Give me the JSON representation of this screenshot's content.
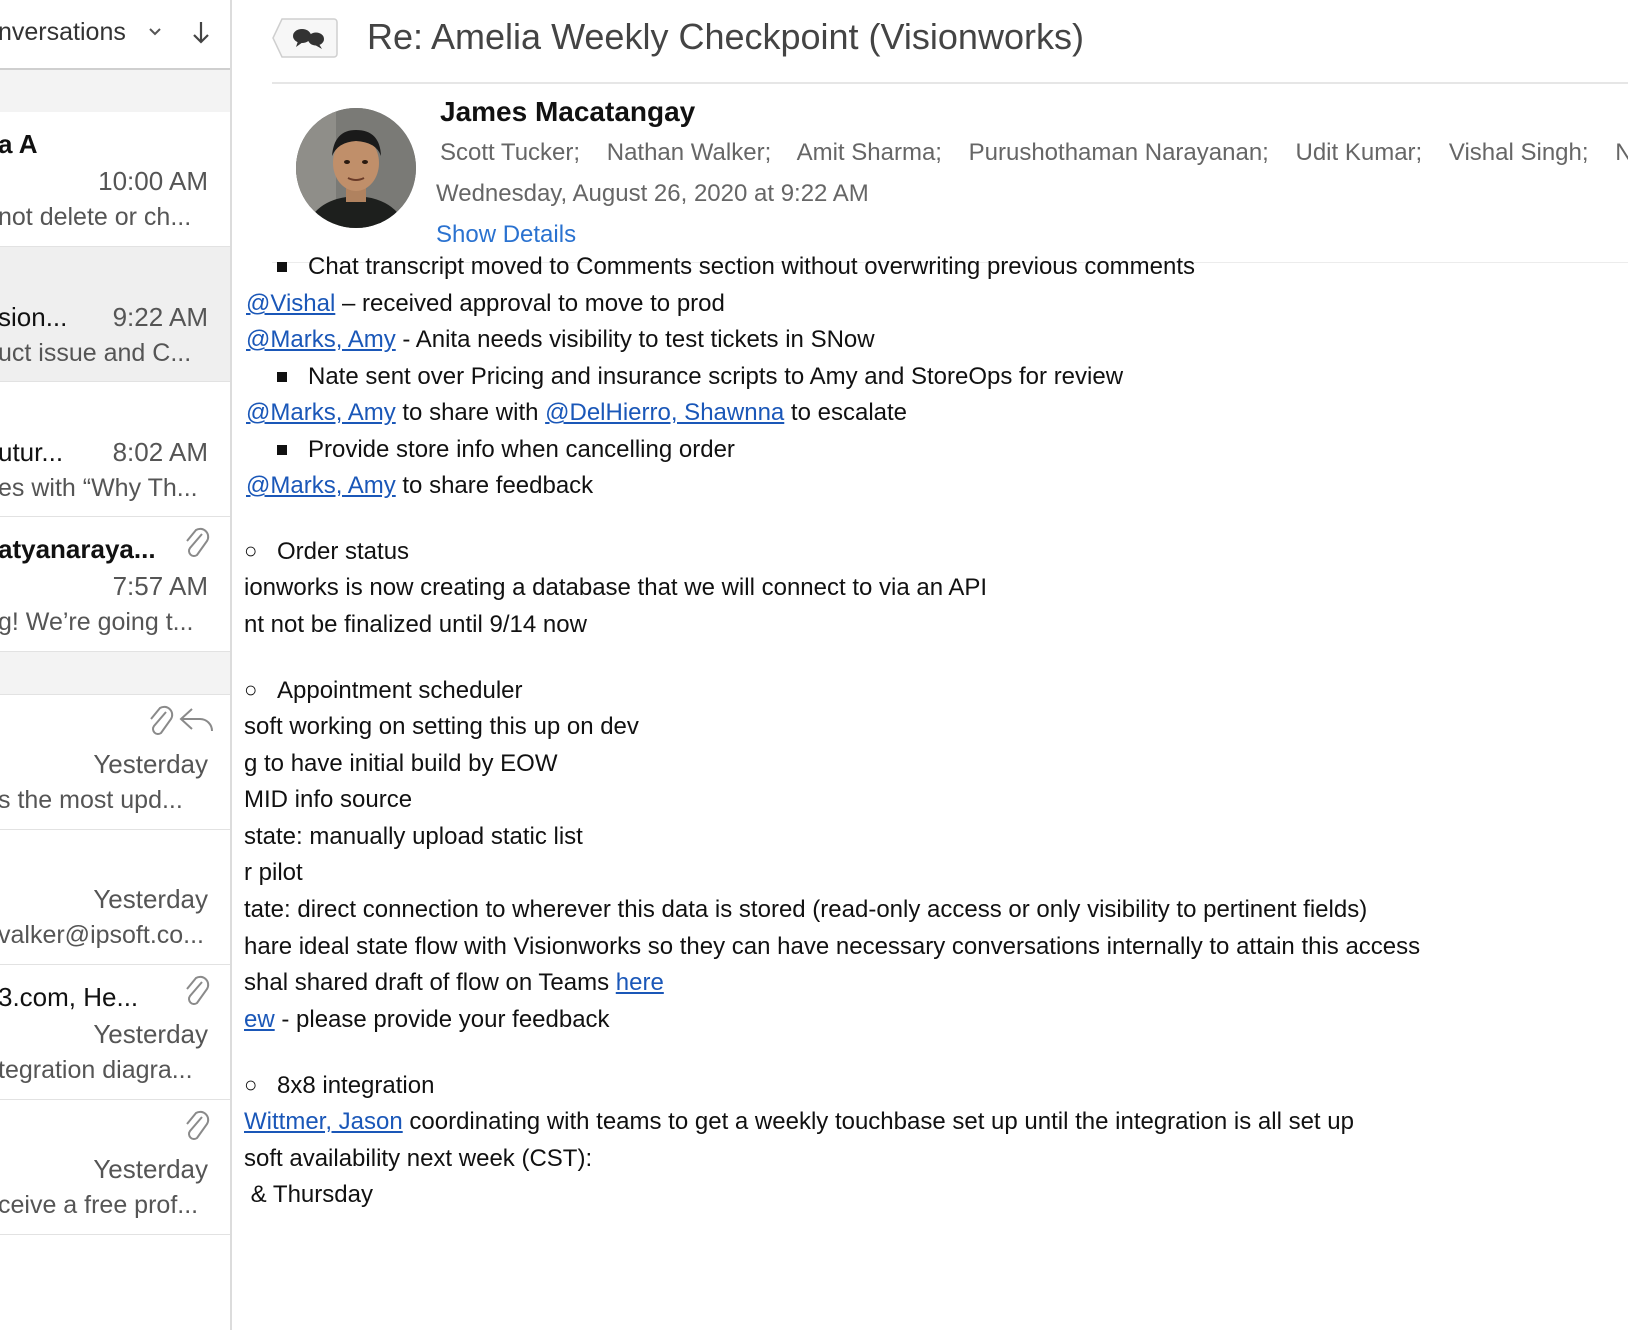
{
  "sidebar": {
    "header_title": "nversations",
    "items": [
      {
        "sender": "a A",
        "time": "10:00 AM",
        "preview": "not delete or ch..."
      },
      {
        "sender": "sion...",
        "time": "9:22 AM",
        "preview": "uct issue and C..."
      },
      {
        "sender": "utur...",
        "time": "8:02 AM",
        "preview": "es with “Why Th..."
      },
      {
        "sender": "atyanaraya...",
        "time": "7:57 AM",
        "preview": "g! We’re going t..."
      },
      {
        "sender": "",
        "time": "Yesterday",
        "preview": "s the most upd..."
      },
      {
        "sender": "",
        "time": "Yesterday",
        "preview": "valker@ipsoft.co..."
      },
      {
        "sender": "3.com, He...",
        "time": "Yesterday",
        "preview": "tegration diagra..."
      },
      {
        "sender": "",
        "time": "Yesterday",
        "preview": "ceive a free prof..."
      }
    ]
  },
  "message": {
    "subject": "Re: Amelia Weekly Checkpoint (Visionworks)",
    "from": "James Macatangay",
    "recipients": [
      "Scott Tucker;",
      "Nathan Walker;",
      "Amit Sharma;",
      "Purushothaman Narayanan;",
      "Udit Kumar;",
      "Vishal Singh;",
      "N"
    ],
    "date": "Wednesday, August 26, 2020 at 9:22 AM",
    "show_details": "Show Details"
  },
  "body": {
    "l1": "Chat transcript moved to Comments section without overwriting previous comments",
    "l2_link": "@Vishal",
    "l2_text": " – received approval to move to prod",
    "l3_link": "@Marks, Amy",
    "l3_text": " - Anita needs visibility to test tickets in SNow",
    "l4": "Nate sent over Pricing and insurance scripts to Amy and StoreOps for review",
    "l5_link1": "@Marks, Amy",
    "l5_mid": " to share with ",
    "l5_link2": "@DelHierro, Shawnna",
    "l5_end": " to escalate",
    "l6": "Provide store info when cancelling order",
    "l7_link": "@Marks, Amy",
    "l7_text": " to share feedback",
    "h1": "Order status",
    "l8": "ionworks is now creating a database that we will connect to via an API",
    "l9": "nt not be finalized until 9/14 now",
    "h2": "Appointment scheduler",
    "l10": "soft working on setting this up on dev",
    "l11": "g to have initial build by EOW",
    "l12": "MID info source",
    "l13": "state: manually upload static list",
    "l14": "r pilot",
    "l15": "tate: direct connection to wherever this data is stored (read-only access or only visibility to pertinent fields)",
    "l16": "hare ideal state flow with Visionworks so they can have necessary conversations internally to attain this access",
    "l17_text": "shal shared draft of flow on Teams ",
    "l17_link": "here",
    "l18_link": "ew",
    "l18_text": " - please provide your feedback",
    "h3": "8x8 integration",
    "l19_link": "Wittmer, Jason",
    "l19_text": " coordinating with teams to get a weekly touchbase set up until the integration is all set up",
    "l20": "soft availability next week (CST):",
    "l21": " & Thursday"
  }
}
